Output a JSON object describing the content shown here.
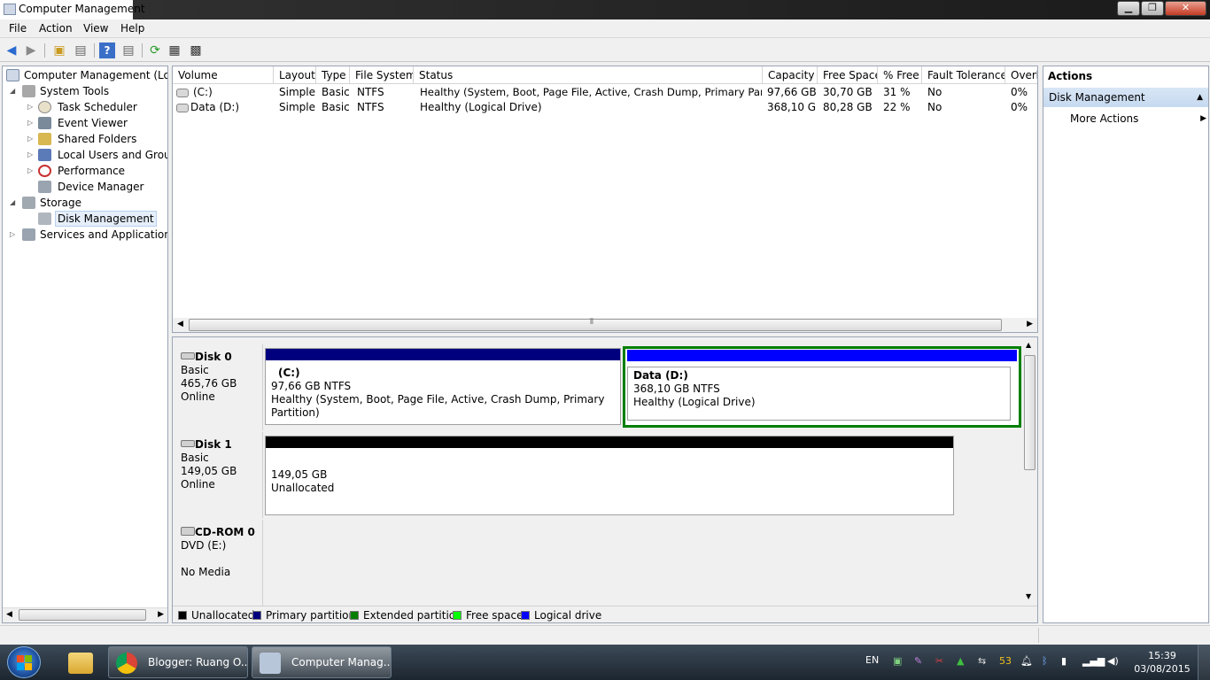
{
  "window": {
    "title": "Computer Management"
  },
  "menu": [
    "File",
    "Action",
    "View",
    "Help"
  ],
  "tree": {
    "root": "Computer Management (Local",
    "system_tools": "System Tools",
    "task_scheduler": "Task Scheduler",
    "event_viewer": "Event Viewer",
    "shared_folders": "Shared Folders",
    "local_users": "Local Users and Groups",
    "performance": "Performance",
    "device_manager": "Device Manager",
    "storage": "Storage",
    "disk_management": "Disk Management",
    "services": "Services and Applications"
  },
  "volumes": {
    "columns": [
      "Volume",
      "Layout",
      "Type",
      "File System",
      "Status",
      "Capacity",
      "Free Space",
      "% Free",
      "Fault Tolerance",
      "Overh"
    ],
    "rows": [
      {
        "volume": "(C:)",
        "layout": "Simple",
        "type": "Basic",
        "fs": "NTFS",
        "status": "Healthy (System, Boot, Page File, Active, Crash Dump, Primary Partition)",
        "capacity": "97,66 GB",
        "free": "30,70 GB",
        "pct": "31 %",
        "fault": "No",
        "overhead": "0%"
      },
      {
        "volume": "Data (D:)",
        "layout": "Simple",
        "type": "Basic",
        "fs": "NTFS",
        "status": "Healthy (Logical Drive)",
        "capacity": "368,10 GB",
        "free": "80,28 GB",
        "pct": "22 %",
        "fault": "No",
        "overhead": "0%"
      }
    ]
  },
  "disks": {
    "disk0": {
      "name": "Disk 0",
      "type": "Basic",
      "size": "465,76 GB",
      "status": "Online"
    },
    "disk1": {
      "name": "Disk 1",
      "type": "Basic",
      "size": "149,05 GB",
      "status": "Online"
    },
    "cdrom0": {
      "name": "CD-ROM 0",
      "type": "DVD (E:)",
      "status": "No Media"
    }
  },
  "partitions": {
    "c": {
      "title": "(C:)",
      "size": "97,66 GB NTFS",
      "status": "Healthy (System, Boot, Page File, Active, Crash Dump, Primary Partition)"
    },
    "d": {
      "title": "Data  (D:)",
      "size": "368,10 GB NTFS",
      "status": "Healthy (Logical Drive)"
    },
    "unalloc": {
      "size": "149,05 GB",
      "status": "Unallocated"
    }
  },
  "legend": [
    {
      "label": "Unallocated",
      "color": "#000000"
    },
    {
      "label": "Primary partition",
      "color": "#00007f"
    },
    {
      "label": "Extended partition",
      "color": "#007f00"
    },
    {
      "label": "Free space",
      "color": "#00ff00"
    },
    {
      "label": "Logical drive",
      "color": "#0000ff"
    }
  ],
  "actions": {
    "header": "Actions",
    "section": "Disk Management",
    "more": "More Actions"
  },
  "taskbar": {
    "task1": "Blogger: Ruang O...",
    "task2": "Computer Manag...",
    "lang": "EN",
    "badge": "53",
    "time": "15:39",
    "date": "03/08/2015"
  }
}
